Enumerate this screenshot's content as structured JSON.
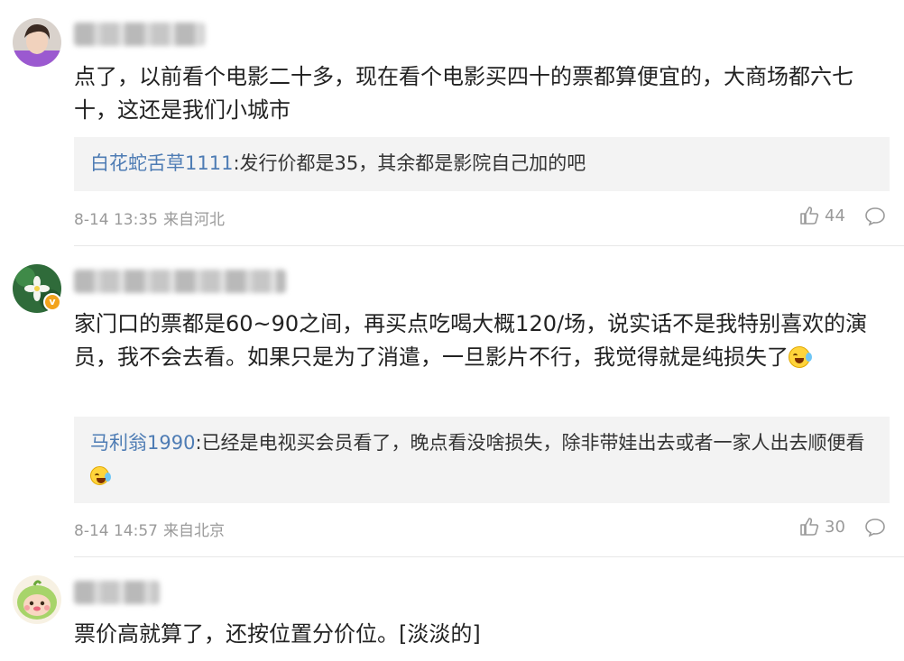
{
  "comments": [
    {
      "text": "点了，以前看个电影二十多，现在看个电影买四十的票都算便宜的，大商场都六七十，这还是我们小城市",
      "reply_user": "白花蛇舌草1111",
      "reply_text": ":发行价都是35，其余都是影院自己加的吧",
      "date": "8-14 13:35",
      "location": "来自河北",
      "likes": "44"
    },
    {
      "text": "家门口的票都是60~90之间，再买点吃喝大概120/场，说实话不是我特别喜欢的演员，我不会去看。如果只是为了消遣，一旦影片不行，我觉得就是纯损失了",
      "reply_user": "马利翁1990",
      "reply_text": ":已经是电视买会员看了，晚点看没啥损失，除非带娃出去或者一家人出去顺便看",
      "date": "8-14 14:57",
      "location": "来自北京",
      "likes": "30"
    },
    {
      "text": "票价高就算了，还按位置分价位。[淡淡的]"
    }
  ],
  "icons": {
    "like": "thumbs-up-icon",
    "comment": "comment-bubble-icon",
    "verified": "verified-badge-icon",
    "emoji": "laughing-crying-emoji-icon"
  },
  "colors": {
    "reply_user": "#4e7cb4",
    "reply_bg": "#f3f3f3",
    "meta": "#9a9a9a",
    "badge": "#f2a31c"
  }
}
